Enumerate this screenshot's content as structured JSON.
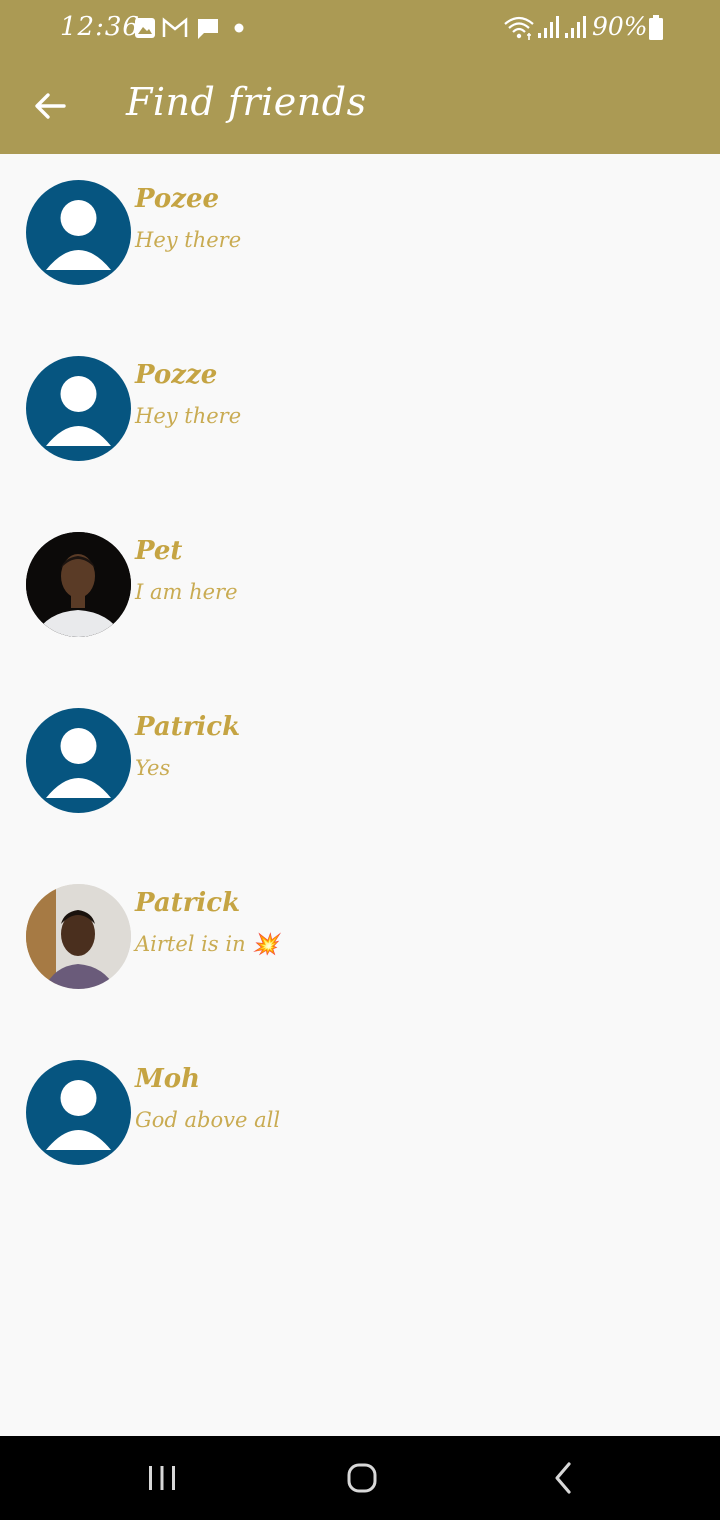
{
  "status_bar": {
    "time": "12:36",
    "battery": "90%",
    "notification_icons": [
      "gallery-icon",
      "gmail-icon",
      "message-icon",
      "dot-icon"
    ],
    "system_icons": [
      "wifi-icon",
      "signal-icon",
      "signal-icon-2",
      "battery-icon"
    ]
  },
  "toolbar": {
    "title": "Find friends",
    "background": "#ab9a54"
  },
  "friends": [
    {
      "name": "Pozee",
      "status": "Hey there",
      "avatar": "default"
    },
    {
      "name": "Pozze",
      "status": "Hey there",
      "avatar": "default"
    },
    {
      "name": "Pet",
      "status": "I am here",
      "avatar": "photo"
    },
    {
      "name": "Patrick",
      "status": "Yes",
      "avatar": "default"
    },
    {
      "name": "Patrick",
      "status": "Airtel is in 💥",
      "avatar": "photo"
    },
    {
      "name": "Moh",
      "status": "God above all",
      "avatar": "default"
    }
  ],
  "colors": {
    "accent_text": "#c5a443",
    "default_avatar": "#065580",
    "background": "#f9f9f9"
  },
  "nav_bar": {
    "buttons": [
      "recent-apps-icon",
      "home-icon",
      "back-icon"
    ]
  }
}
